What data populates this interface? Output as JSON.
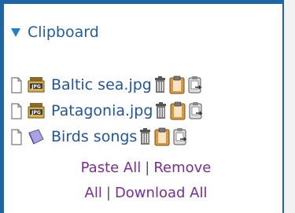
{
  "panel": {
    "title": "Clipboard"
  },
  "files": [
    {
      "name": "Baltic sea.jpg",
      "type": "jpg"
    },
    {
      "name": "Patagonia.jpg",
      "type": "jpg"
    },
    {
      "name": "Birds songs",
      "type": "folder"
    }
  ],
  "actions": {
    "paste_all": "Paste All",
    "separator": "|",
    "remove_all_part1": "Remove",
    "remove_all_part2": "All",
    "download_all": "Download All"
  },
  "colors": {
    "border": "#1e65a8",
    "link": "#1f54a8",
    "action": "#7e2a9c",
    "triangle": "#1c7fd4"
  }
}
